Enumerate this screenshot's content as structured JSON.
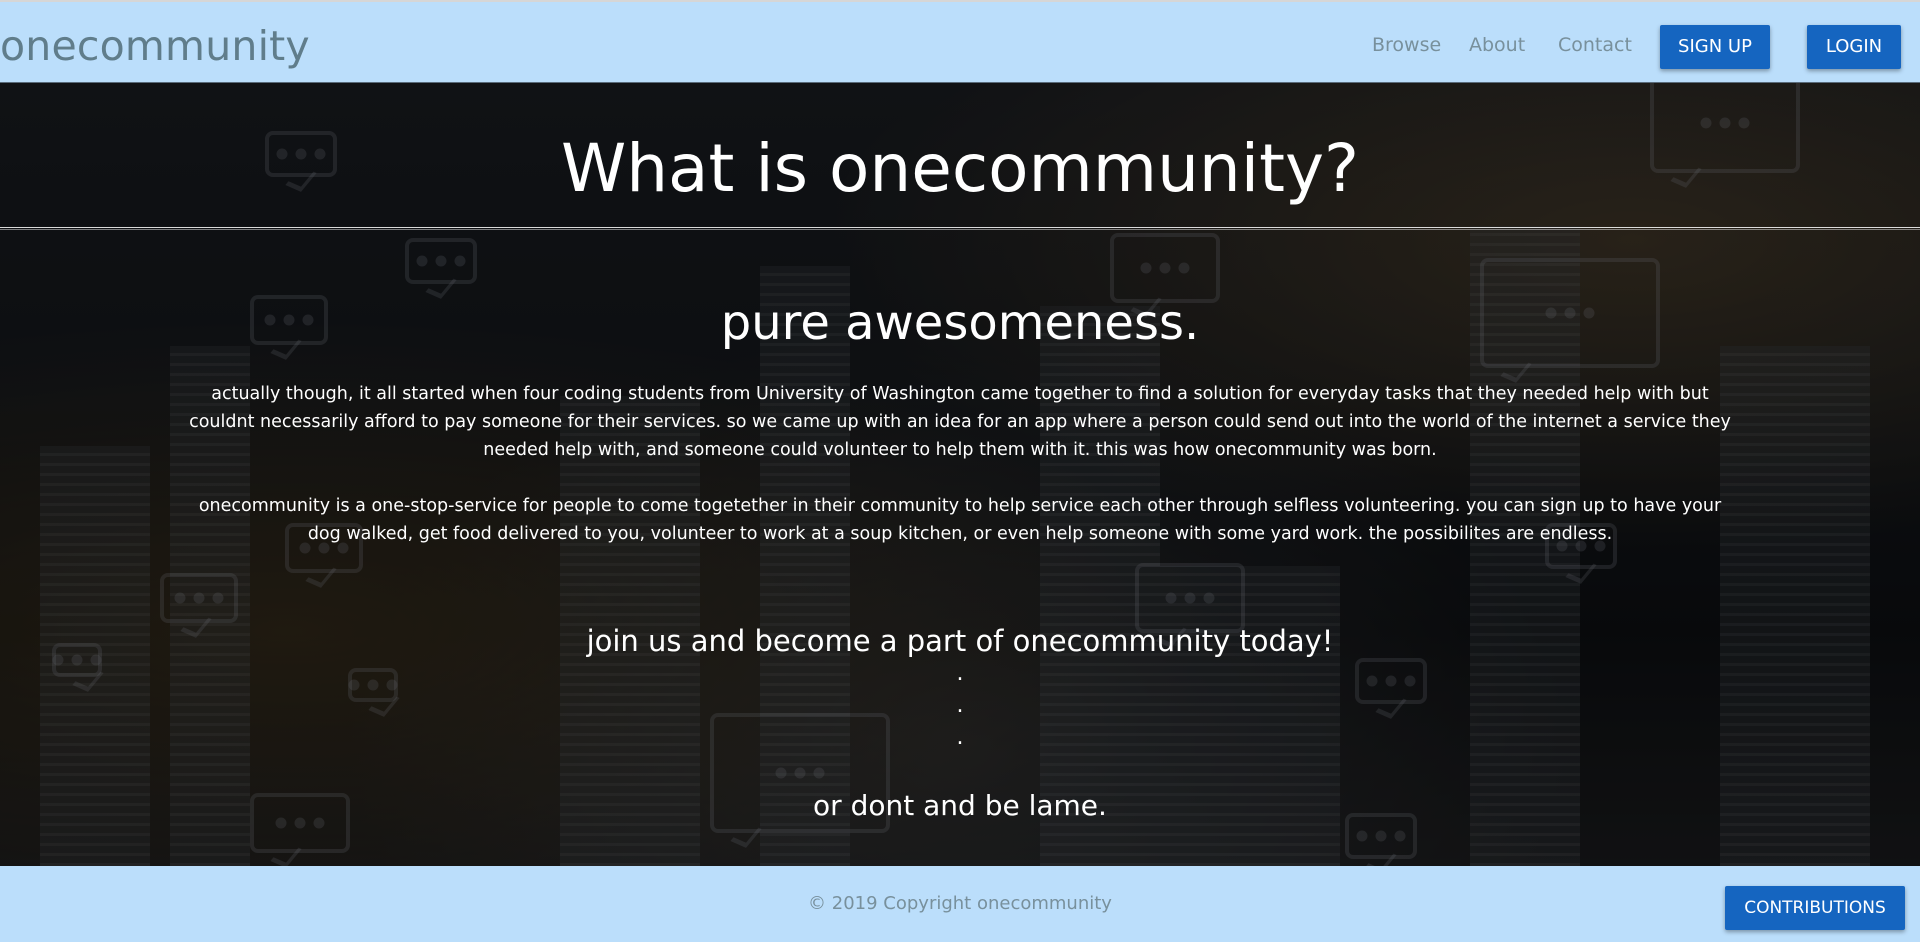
{
  "navbar": {
    "brand": "onecommunity",
    "links": [
      "Browse",
      "About",
      "Contact"
    ],
    "signup_label": "SIGN UP",
    "login_label": "LOGIN",
    "background_color": "#bbdefb",
    "button_color": "#1565c0"
  },
  "hero": {
    "title": "What is onecommunity?",
    "subtitle": "pure awesomeness.",
    "paragraph_1": "actually though, it all started when four coding students from University of Washington came together to find a solution for everyday tasks that they needed help with but couldnt necessarily afford to pay someone for their services. so we came up with an idea for an app where a person could send out into the world of the internet a service they needed help with, and someone could volunteer to help them with it. this was how onecommunity was born.",
    "paragraph_2": "onecommunity is a one-stop-service for people to come togetether in their community to help service each other through selfless volunteering. you can sign up to have your dog walked, get food delivered to you, volunteer to work at a soup kitchen, or even help someone with some yard work. the possibilites are endless.",
    "cta": "join us and become a part of onecommunity today!",
    "dots": [
      ".",
      ".",
      "."
    ],
    "alt": "or dont and be lame."
  },
  "footer": {
    "copyright": "© 2019 Copyright onecommunity",
    "contributions_label": "CONTRIBUTIONS"
  }
}
